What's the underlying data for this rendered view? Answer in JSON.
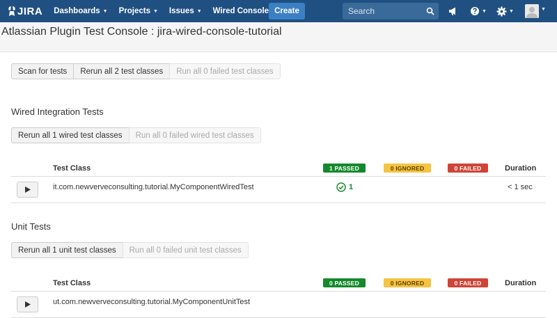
{
  "topnav": {
    "logo_text": "JIRA",
    "menu": [
      {
        "label": "Dashboards"
      },
      {
        "label": "Projects"
      },
      {
        "label": "Issues"
      }
    ],
    "wired_console": "Wired Console",
    "create_label": "Create",
    "search_placeholder": "Search",
    "icons": [
      "megaphone-icon",
      "help-icon",
      "gear-icon",
      "avatar"
    ],
    "colors": {
      "bar": "#205081",
      "create": "#3b7fc4"
    }
  },
  "page": {
    "title": "Atlassian Plugin Test Console : jira-wired-console-tutorial"
  },
  "global_actions": {
    "scan": "Scan for tests",
    "rerun_all": "Rerun all 2 test classes",
    "run_failed": "Run all 0 failed test classes"
  },
  "sections": [
    {
      "title": "Wired Integration Tests",
      "rerun": "Rerun all 1 wired test classes",
      "run_failed": "Run all 0 failed wired test classes",
      "headers": {
        "test_class": "Test Class",
        "passed": "1 PASSED",
        "ignored": "0 IGNORED",
        "failed": "0 FAILED",
        "duration": "Duration"
      },
      "rows": [
        {
          "name": "it.com.newverveconsulting.tutorial.MyComponentWiredTest",
          "passed": "1",
          "duration": "< 1 sec"
        }
      ]
    },
    {
      "title": "Unit Tests",
      "rerun": "Rerun all 1 unit test classes",
      "run_failed": "Run all 0 failed unit test classes",
      "headers": {
        "test_class": "Test Class",
        "passed": "0 PASSED",
        "ignored": "0 IGNORED",
        "failed": "0 FAILED",
        "duration": "Duration"
      },
      "rows": [
        {
          "name": "ut.com.newverveconsulting.tutorial.MyComponentUnitTest",
          "passed": "",
          "duration": ""
        }
      ]
    }
  ],
  "status_colors": {
    "passed": "#14892c",
    "ignored": "#f6c342",
    "failed": "#d04437"
  }
}
